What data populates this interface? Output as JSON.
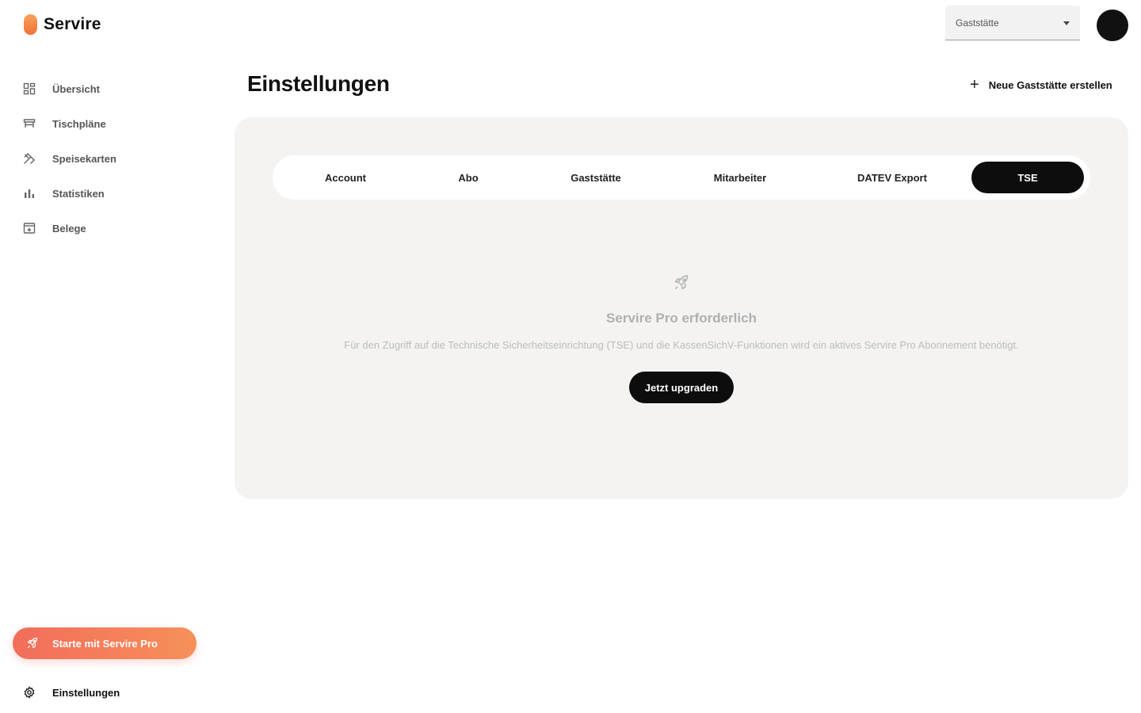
{
  "app": {
    "name": "Servire"
  },
  "sidebar": {
    "items": [
      {
        "label": "Übersicht",
        "icon": "dashboard-icon"
      },
      {
        "label": "Tischpläne",
        "icon": "table-icon"
      },
      {
        "label": "Speisekarten",
        "icon": "utensils-icon"
      },
      {
        "label": "Statistiken",
        "icon": "bar-chart-icon"
      },
      {
        "label": "Belege",
        "icon": "receipt-archive-icon"
      }
    ],
    "pro_button": {
      "label": "Starte mit Servire Pro",
      "icon": "rocket-icon"
    },
    "settings": {
      "label": "Einstellungen",
      "icon": "gear-icon"
    }
  },
  "header": {
    "venue_select": {
      "value": "Gaststätte"
    },
    "new_venue_label": "Neue Gaststätte erstellen"
  },
  "page": {
    "title": "Einstellungen"
  },
  "tabs": [
    {
      "label": "Account",
      "active": false
    },
    {
      "label": "Abo",
      "active": false
    },
    {
      "label": "Gaststätte",
      "active": false
    },
    {
      "label": "Mitarbeiter",
      "active": false
    },
    {
      "label": "DATEV Export",
      "active": false
    },
    {
      "label": "TSE",
      "active": true
    }
  ],
  "empty_state": {
    "icon": "rocket-icon",
    "title": "Servire Pro erforderlich",
    "description": "Für den Zugriff auf die Technische Sicherheitseinrichtung (TSE) und die KassenSichV-Funktionen wird ein aktives Servire Pro Abonnement benötigt.",
    "button_label": "Jetzt upgraden"
  },
  "colors": {
    "accent_start": "#f26d5b",
    "accent_end": "#f7905a",
    "panel_bg": "#f4f3f2",
    "active_tab_bg": "#0d0d0d"
  }
}
